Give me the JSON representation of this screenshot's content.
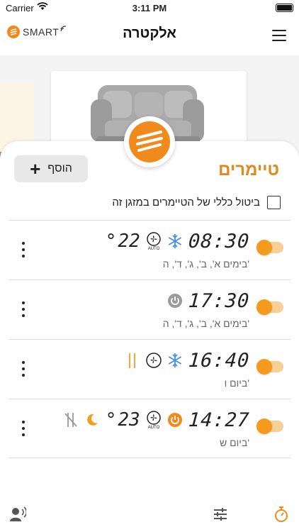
{
  "status": {
    "carrier": "Carrier",
    "time": "3:11 PM"
  },
  "header": {
    "logo_text": "SMART",
    "title": "אלקטרה"
  },
  "timers_section": {
    "title": "טיימרים",
    "add_label": "הוסף",
    "cancel_all_label": "ביטול כללי של הטיימרים במזגן זה"
  },
  "timers": [
    {
      "time": "08:30",
      "temperature": "22",
      "days": "בימים א', ב', ג', ד', ה'",
      "icons": [
        "snowflake-icon",
        "fan-auto-icon"
      ]
    },
    {
      "time": "17:30",
      "temperature": "",
      "days": "בימים א', ב', ג', ד', ה'",
      "icons": [
        "power-off-icon"
      ]
    },
    {
      "time": "16:40",
      "temperature": "",
      "days": "ביום ו'",
      "icons": [
        "snowflake-icon",
        "fan-icon",
        "swing-icon"
      ]
    },
    {
      "time": "14:27",
      "temperature": "23",
      "days": "ביום ש'",
      "icons": [
        "power-on-icon",
        "fan-auto-icon",
        "moon-icon",
        "swing-off-icon"
      ]
    }
  ],
  "colors": {
    "accent": "#e0891f",
    "toggle": "#f49a1c",
    "snowflake": "#4a90e2"
  },
  "tabs": [
    "voice-icon",
    "sliders-icon",
    "timer-icon"
  ]
}
